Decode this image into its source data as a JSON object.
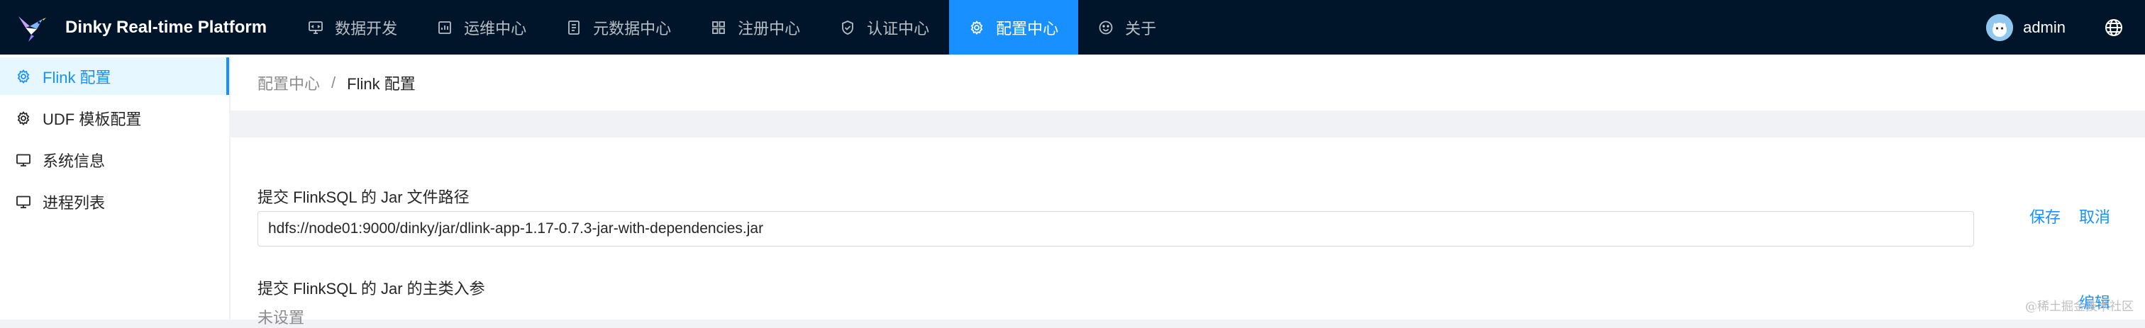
{
  "app": {
    "title": "Dinky Real-time Platform"
  },
  "nav": {
    "items": [
      {
        "label": "数据开发",
        "icon": "desktop-code-icon"
      },
      {
        "label": "运维中心",
        "icon": "monitor-box-icon"
      },
      {
        "label": "元数据中心",
        "icon": "document-icon"
      },
      {
        "label": "注册中心",
        "icon": "appstore-icon"
      },
      {
        "label": "认证中心",
        "icon": "shield-check-icon"
      },
      {
        "label": "配置中心",
        "icon": "gear-icon",
        "active": true
      },
      {
        "label": "关于",
        "icon": "smile-icon"
      }
    ]
  },
  "user": {
    "name": "admin"
  },
  "sidebar": {
    "items": [
      {
        "label": "Flink 配置",
        "icon": "gear-icon",
        "active": true
      },
      {
        "label": "UDF 模板配置",
        "icon": "gear-icon"
      },
      {
        "label": "系统信息",
        "icon": "monitor-icon"
      },
      {
        "label": "进程列表",
        "icon": "monitor-icon"
      }
    ]
  },
  "breadcrumb": {
    "parent": "配置中心",
    "separator": "/",
    "current": "Flink 配置"
  },
  "settings": {
    "jar_path": {
      "label": "提交 FlinkSQL 的 Jar 文件路径",
      "value": "hdfs://node01:9000/dinky/jar/dlink-app-1.17-0.7.3-jar-with-dependencies.jar",
      "save_label": "保存",
      "cancel_label": "取消"
    },
    "main_args": {
      "label": "提交 FlinkSQL 的 Jar 的主类入参",
      "value": "未设置",
      "edit_label": "编辑"
    }
  },
  "watermark": "@稀土掘金技术社区",
  "colors": {
    "header_bg": "#001529",
    "accent": "#1890ff",
    "sidebar_active_bg": "#e6f7ff",
    "content_bg": "#f0f2f5"
  }
}
